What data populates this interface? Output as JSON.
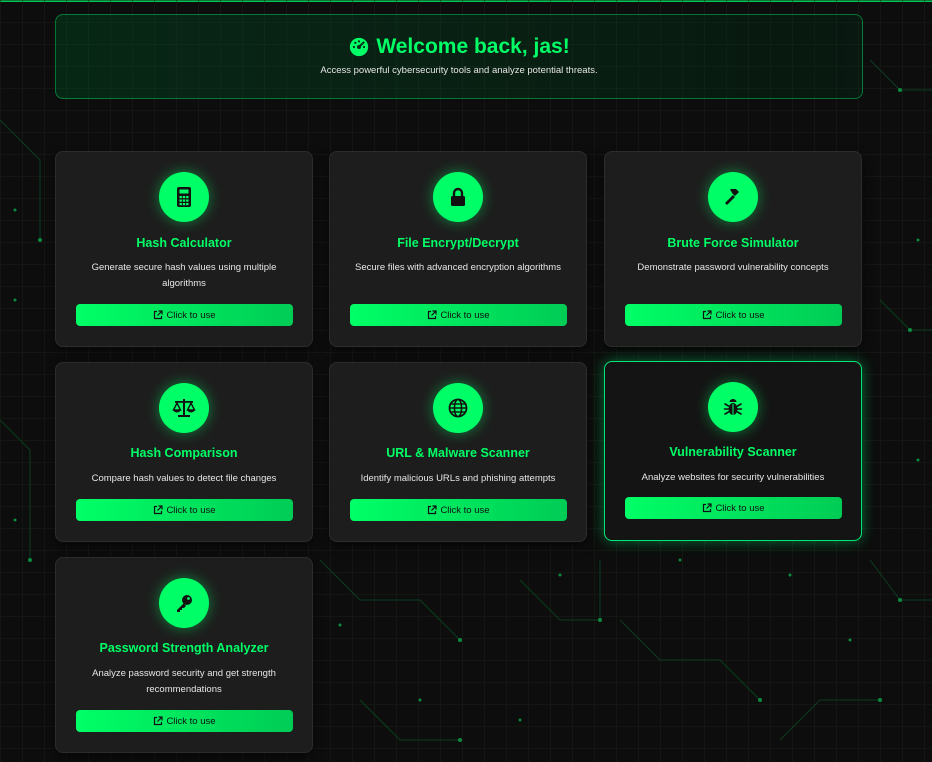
{
  "header": {
    "title": "Welcome back, jas!",
    "subtitle": "Access powerful cybersecurity tools and analyze potential threats.",
    "icon": "gauge-icon"
  },
  "colors": {
    "accent": "#00ff66",
    "background": "#0c0d0c",
    "card": "#1d1d1d"
  },
  "tools": [
    {
      "title": "Hash Calculator",
      "description": "Generate secure hash values using multiple algorithms",
      "icon": "calculator-icon",
      "button_label": "Click to use"
    },
    {
      "title": "File Encrypt/Decrypt",
      "description": "Secure files with advanced encryption algorithms",
      "icon": "lock-icon",
      "button_label": "Click to use"
    },
    {
      "title": "Brute Force Simulator",
      "description": "Demonstrate password vulnerability concepts",
      "icon": "hammer-icon",
      "button_label": "Click to use"
    },
    {
      "title": "Hash Comparison",
      "description": "Compare hash values to detect file changes",
      "icon": "scale-icon",
      "button_label": "Click to use"
    },
    {
      "title": "URL & Malware Scanner",
      "description": "Identify malicious URLs and phishing attempts",
      "icon": "globe-icon",
      "button_label": "Click to use"
    },
    {
      "title": "Vulnerability Scanner",
      "description": "Analyze websites for security vulnerabilities",
      "icon": "bug-icon",
      "button_label": "Click to use"
    },
    {
      "title": "Password Strength Analyzer",
      "description": "Analyze password security and get strength recommendations",
      "icon": "key-icon",
      "button_label": "Click to use"
    }
  ]
}
